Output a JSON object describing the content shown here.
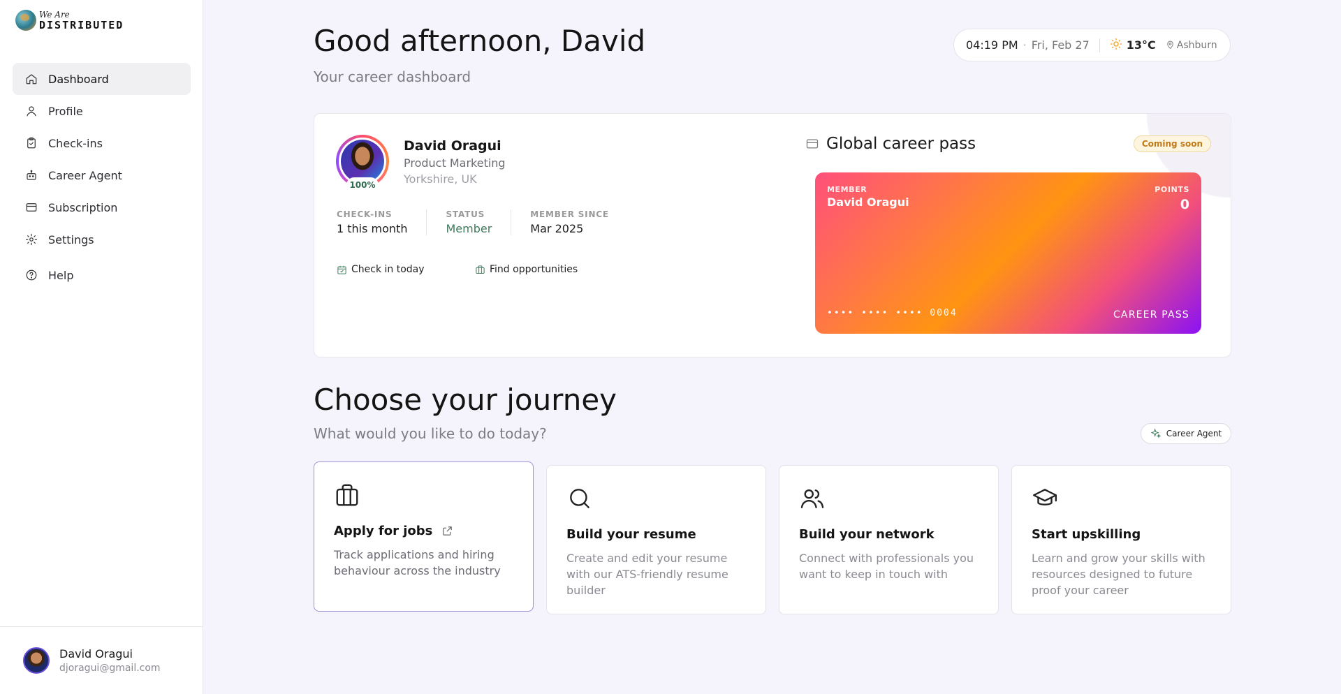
{
  "brand": {
    "line1": "We Are",
    "line2": "DISTRIBUTED"
  },
  "sidebar": {
    "items": [
      {
        "label": "Dashboard",
        "icon": "home-icon",
        "active": true
      },
      {
        "label": "Profile",
        "icon": "user-icon"
      },
      {
        "label": "Check-ins",
        "icon": "clipboard-check-icon"
      },
      {
        "label": "Career Agent",
        "icon": "robot-icon"
      },
      {
        "label": "Subscription",
        "icon": "credit-card-icon"
      },
      {
        "label": "Settings",
        "icon": "gear-icon"
      },
      {
        "label": "Help",
        "icon": "help-circle-icon"
      }
    ],
    "user": {
      "name": "David Oragui",
      "email": "djoragui@gmail.com"
    }
  },
  "header": {
    "greeting": "Good afternoon, David",
    "subtitle": "Your career dashboard",
    "time": "04:19 PM",
    "date": "Fri, Feb 27",
    "temperature": "13°C",
    "location": "Ashburn",
    "dot": "·"
  },
  "profile": {
    "name": "David Oragui",
    "role": "Product Marketing",
    "location": "Yorkshire, UK",
    "completion": "100%",
    "stats": [
      {
        "label": "CHECK-INS",
        "value": "1 this month"
      },
      {
        "label": "STATUS",
        "value": "Member"
      },
      {
        "label": "MEMBER SINCE",
        "value": "Mar 2025"
      }
    ],
    "actions": {
      "checkin": "Check in today",
      "find": "Find opportunities"
    }
  },
  "career_pass": {
    "title": "Global career pass",
    "badge": "Coming soon",
    "member_label": "MEMBER",
    "member_name": "David Oragui",
    "points_label": "POINTS",
    "points_value": "0",
    "card_number": "•••• •••• •••• 0004",
    "card_label": "CAREER PASS",
    "gradient_colors": [
      "#ff4f7b",
      "#ff9412",
      "#8a12f5"
    ]
  },
  "journey": {
    "title": "Choose your journey",
    "subtitle": "What would you like to do today?",
    "agent_button": "Career Agent",
    "cards": [
      {
        "title": "Apply for jobs",
        "desc": "Track applications and hiring behaviour across the industry",
        "icon": "briefcase-icon",
        "external": true
      },
      {
        "title": "Build your resume",
        "desc": "Create and edit your resume with our ATS-friendly resume builder",
        "icon": "search-icon"
      },
      {
        "title": "Build your network",
        "desc": "Connect with professionals you want to keep in touch with",
        "icon": "users-icon"
      },
      {
        "title": "Start upskilling",
        "desc": "Learn and grow your skills with resources designed to future proof your career",
        "icon": "graduation-cap-icon"
      }
    ]
  }
}
